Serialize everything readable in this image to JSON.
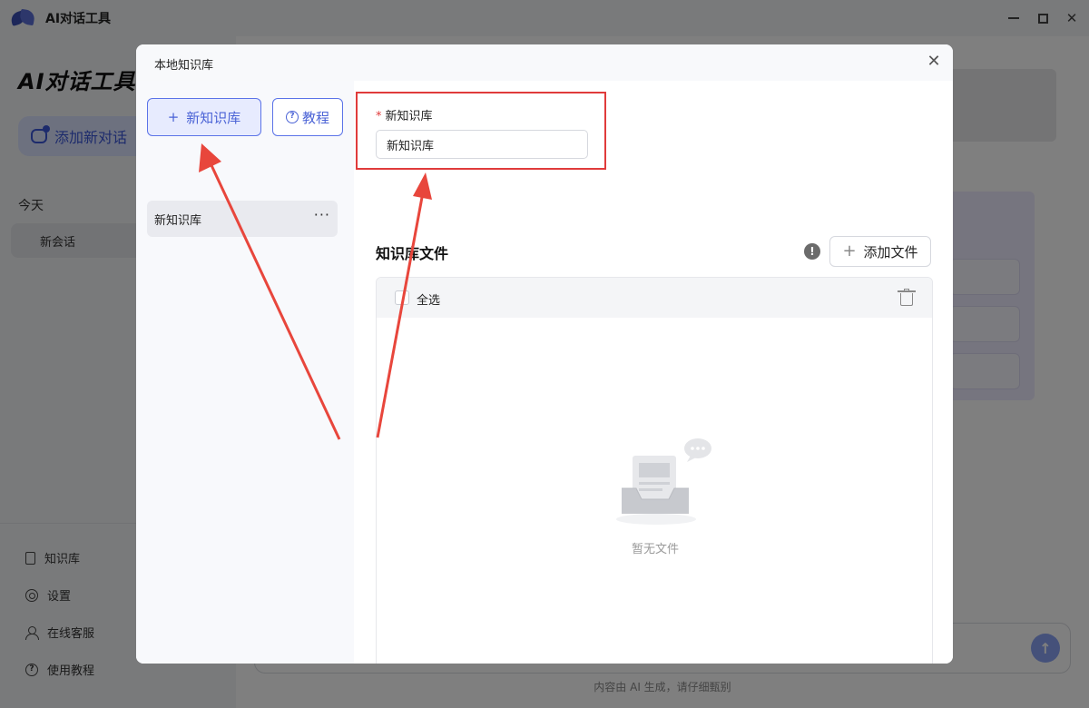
{
  "app": {
    "title": "AI对话工具",
    "brand": "AI对话工具",
    "new_chat_label": "添加新对话",
    "section_today": "今天",
    "session_item": "新会话",
    "menu": [
      {
        "label": "知识库",
        "icon": "book-icon"
      },
      {
        "label": "设置",
        "icon": "gear-icon"
      },
      {
        "label": "在线客服",
        "icon": "user-icon"
      },
      {
        "label": "使用教程",
        "icon": "help-icon"
      }
    ],
    "footer_note": "内容由 AI 生成，请仔细甄别"
  },
  "modal": {
    "title": "本地知识库",
    "new_kb_button": "新知识库",
    "tutorial_button": "教程",
    "kb_list": [
      "新知识库"
    ],
    "form": {
      "name_label": "新知识库",
      "name_required": true,
      "name_value": "新知识库"
    },
    "files": {
      "title": "知识库文件",
      "add_file_button": "添加文件",
      "select_all_label": "全选",
      "empty_text": "暂无文件"
    }
  },
  "colors": {
    "accent": "#4b63d6",
    "highlight": "#e03b3b",
    "arrow": "#e8463c"
  }
}
